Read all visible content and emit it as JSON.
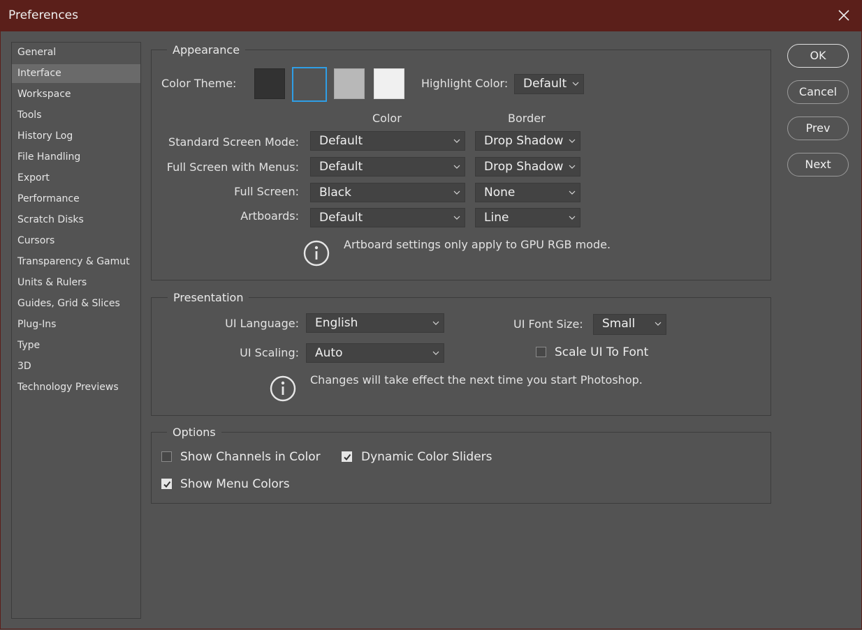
{
  "window": {
    "title": "Preferences"
  },
  "sidebar": {
    "items": [
      {
        "label": "General"
      },
      {
        "label": "Interface"
      },
      {
        "label": "Workspace"
      },
      {
        "label": "Tools"
      },
      {
        "label": "History Log"
      },
      {
        "label": "File Handling"
      },
      {
        "label": "Export"
      },
      {
        "label": "Performance"
      },
      {
        "label": "Scratch Disks"
      },
      {
        "label": "Cursors"
      },
      {
        "label": "Transparency & Gamut"
      },
      {
        "label": "Units & Rulers"
      },
      {
        "label": "Guides, Grid & Slices"
      },
      {
        "label": "Plug-Ins"
      },
      {
        "label": "Type"
      },
      {
        "label": "3D"
      },
      {
        "label": "Technology Previews"
      }
    ],
    "selected": "Interface"
  },
  "appearance": {
    "title": "Appearance",
    "color_theme_label": "Color Theme:",
    "themes": [
      "#323232",
      "#535353",
      "#b8b8b8",
      "#f0f0f0"
    ],
    "selected_theme_color": "#535353",
    "highlight_label": "Highlight Color:",
    "highlight_value": "Default",
    "col_color": "Color",
    "col_border": "Border",
    "rows": [
      {
        "label": "Standard Screen Mode:",
        "color": "Default",
        "border": "Drop Shadow"
      },
      {
        "label": "Full Screen with Menus:",
        "color": "Default",
        "border": "Drop Shadow"
      },
      {
        "label": "Full Screen:",
        "color": "Black",
        "border": "None"
      },
      {
        "label": "Artboards:",
        "color": "Default",
        "border": "Line"
      }
    ],
    "info": "Artboard settings only apply to GPU RGB mode."
  },
  "presentation": {
    "title": "Presentation",
    "ui_language_label": "UI Language:",
    "ui_language_value": "English",
    "ui_font_size_label": "UI Font Size:",
    "ui_font_size_value": "Small",
    "ui_scaling_label": "UI Scaling:",
    "ui_scaling_value": "Auto",
    "scale_ui_label": "Scale UI To Font",
    "scale_ui_checked": false,
    "info": "Changes will take effect the next time you start Photoshop."
  },
  "options": {
    "title": "Options",
    "show_channels_label": "Show Channels in Color",
    "show_channels_checked": false,
    "dynamic_sliders_label": "Dynamic Color Sliders",
    "dynamic_sliders_checked": true,
    "show_menu_colors_label": "Show Menu Colors",
    "show_menu_colors_checked": true
  },
  "buttons": {
    "ok": "OK",
    "cancel": "Cancel",
    "prev": "Prev",
    "next": "Next"
  },
  "colors": {
    "titlebar": "#5b1f1a",
    "panel": "#535353",
    "accent": "#2f9ee6"
  }
}
